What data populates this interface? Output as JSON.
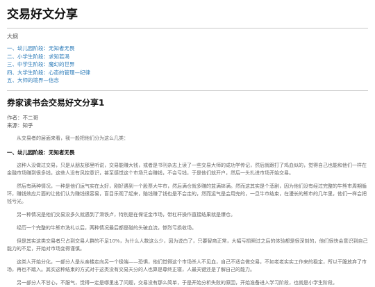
{
  "site": {
    "title": "交易好文分享"
  },
  "toc": {
    "heading": "大纲",
    "items": [
      "一、幼儿园阶段：无知者无畏",
      "二、小学生阶段：求知若渴",
      "三、中学生阶段：魔幻的世界",
      "四、大学生阶段：心态的管理—纪律",
      "五、大师的境界—信念"
    ]
  },
  "article": {
    "title": "券家读书会交易好文分享1",
    "author": "作者：不二哥",
    "source": "来源：知乎",
    "intro": "从交易者的层面来看，我一般把他们分为这么几类：",
    "section1_heading": "一、幼儿园阶段：无知者无畏",
    "paragraphs": [
      "这种人没做过交易，只是从朋友那里听说，交易能赚大钱，或者是书刊杂志上读了一些交易大师的成功学传记，然后就跟打了鸡血似的，觉得自己也能和他们一样在金融市场赚到很多钱，这些人没有风控意识，甚至感觉这个市场只会赚钱，不会亏钱，于是他们就开户，然后一头扎进市场开始交易。",
      "然后有两种情况，一种是他们运气实在太好，刚好遇到一个股票大牛市，然后满仓就多赚的盆满钵满。然而这其实是个悲剧，因为他们没有经过完整的牛熊市周期循环，赚钱效应片面的让他们认为赚钱很容易，盲目乐观了起来，赔钱赚了钱也是不会走的，然而运气是会用完的，一旦牛市结束，在漫长的熊市的几年里，他们一样会把钱亏光。",
      "另一种情况是他们交易没多久就遇到了滑铁卢，特别是在保证金市场，带杠杆操作直接结果就是爆仓。",
      "经历一个完整的牛熊市洗礼以后，两种情况最后都是碰的头破血流，惨烈亏损收场。",
      "但是其实这类交易者只占到交易人群的不足10%，为什么人数这么少，因为说白了，只要智商正常，大幅亏损瞬过之后的体验都是很深刻的，他们很快会意识到自己能力的不足，开始对市场变得谨慎。",
      "这类人开始分化，一部分人是从亲楼走向另一个极端——恐惧，他们觉得这个市场杀人不见血，自己不适合做交易，不如老老实实工作来的稳定，所以干脆放弃了市场，再也不踏入。其实这种结束的方式对于这类没有交易天分的人也算是尊终正寝，人最关键还是了解自己的能力。",
      "另一部分人不甘心，不服气，觉得一定是哪里出了问题，交易没有那么简单，于是开始分析失败的原因，开始准备进入学习阶段，也就是小学生阶段。"
    ]
  }
}
